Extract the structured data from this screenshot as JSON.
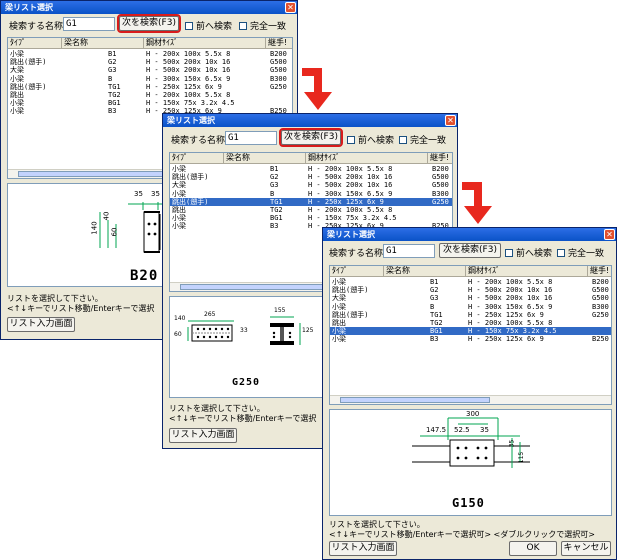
{
  "window": {
    "title": "梁リスト選択",
    "close_glyph": "✕"
  },
  "search": {
    "label": "検索する名称:",
    "value": "G1",
    "next_button": "次を検索(F3)",
    "prev_label": "前へ検索",
    "exact_label": "完全一致"
  },
  "columns": {
    "type": "ﾀｲﾌﾟ",
    "name": "梁名称",
    "size": "鋼材ｻｲｽﾞ",
    "end": "継手!"
  },
  "rows": [
    {
      "type": "小梁",
      "name": "B1",
      "size": "H  -  200x  100x  5.5x    8",
      "code": "B200"
    },
    {
      "type": "跳出(遡手)",
      "name": "G2",
      "size": "H  -  500x  200x   10x   16",
      "code": "G500"
    },
    {
      "type": "大梁",
      "name": "G3",
      "size": "H  -  500x  200x   10x   16",
      "code": "G500"
    },
    {
      "type": "小梁",
      "name": "B",
      "size": "H  -  300x  150x  6.5x    9",
      "code": "B300"
    },
    {
      "type": "跳出(遡手)",
      "name": "TG1",
      "size": "H  -  250x  125x    6x    9",
      "code": "G250"
    },
    {
      "type": "跳出",
      "name": "TG2",
      "size": "H  -  200x  100x  5.5x    8",
      "code": ""
    },
    {
      "type": "小梁",
      "name": "BG1",
      "size": "H  -  150x   75x  3.2x  4.5",
      "code": ""
    },
    {
      "type": "小梁",
      "name": "B3",
      "size": "H  -  250x  125x    6x    9",
      "code": "B250"
    }
  ],
  "rows_w3_override": [
    {
      "type": "小梁",
      "name": "B1",
      "size": "H  -  200x  100x  5.5x    8",
      "code": "B200"
    },
    {
      "type": "跳出(遡手)",
      "name": "G2",
      "size": "H  -  500x  200x   10x   16",
      "code": "G500"
    },
    {
      "type": "大梁",
      "name": "G3",
      "size": "H  -  500x  200x   10x   16",
      "code": "G500"
    },
    {
      "type": "小梁",
      "name": "B",
      "size": "H  -  300x  150x  6.5x    9",
      "code": "B300"
    },
    {
      "type": "跳出(遡手)",
      "name": "TG1",
      "size": "H  -  250x  125x    6x    9",
      "code": "G250"
    },
    {
      "type": "跳出",
      "name": "TG2",
      "size": "H  -  200x  100x  5.5x    8",
      "code": ""
    },
    {
      "type": "小梁",
      "name": "BG1",
      "size": "H  -  150x   75x  3.2x  4.5",
      "code": ""
    },
    {
      "type": "小梁",
      "name": "B3",
      "size": "H  -  250x  125x    6x    9",
      "code": "B250"
    }
  ],
  "selected": {
    "w1": -1,
    "w2": 4,
    "w3": 6
  },
  "preview": {
    "w1": {
      "label": "B20",
      "dims": [
        "35",
        "35",
        "140",
        "40",
        "60"
      ]
    },
    "w2": {
      "label": "G250",
      "dims": [
        "265",
        "140",
        "60",
        "33",
        "155",
        "125"
      ]
    },
    "w3": {
      "label": "G150",
      "dims": [
        "300",
        "147.5",
        "52.5",
        "35",
        "35",
        "115"
      ]
    }
  },
  "status": {
    "line1": "リストを選択して下さい。",
    "line2_w1": "<↑↓キーでリスト移動/Enterキーで選択",
    "line2_w2": "<↑↓キーでリスト移動/Enterキーで選択",
    "line2_w3": "<↑↓キーでリスト移動/Enterキーで選択可> <ダブルクリックで選択可>"
  },
  "buttons": {
    "list_input": "リスト入力画面",
    "ok": "OK",
    "cancel": "キャンセル"
  },
  "colors": {
    "highlight": "#d81b1b",
    "selection": "#316ac5",
    "titlebar": "#0a52c7"
  }
}
